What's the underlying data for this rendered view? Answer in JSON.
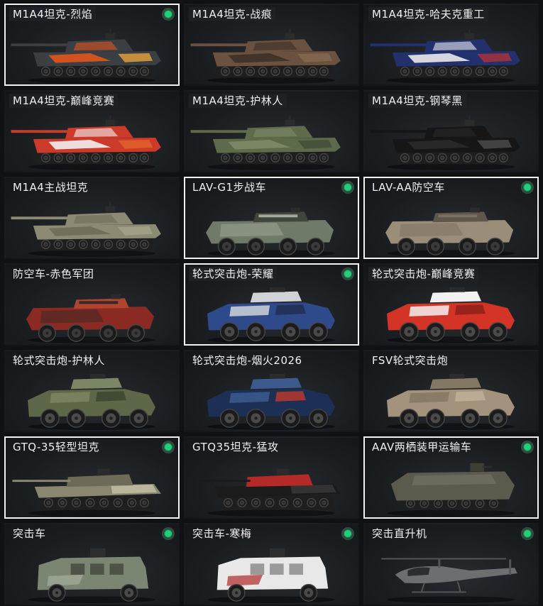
{
  "vehicles": [
    {
      "label": "M1A4坦克-烈焰",
      "type": "tank",
      "colors": [
        "#3a3f44",
        "#e0541c",
        "#ffb13b"
      ],
      "selected": true,
      "indicator": true,
      "label_bg": true
    },
    {
      "label": "M1A4坦克-战痕",
      "type": "tank",
      "colors": [
        "#6a5140",
        "#3f3128",
        "#8a6e52"
      ],
      "selected": false,
      "indicator": false,
      "label_bg": true
    },
    {
      "label": "M1A4坦克-哈夫克重工",
      "type": "tank",
      "colors": [
        "#22306e",
        "#eaeaea",
        "#c43030"
      ],
      "selected": false,
      "indicator": false,
      "label_bg": true
    },
    {
      "label": "M1A4坦克-巅峰竞赛",
      "type": "tank",
      "colors": [
        "#cc3a2a",
        "#f1f1f1",
        "#e56a2b"
      ],
      "selected": false,
      "indicator": false,
      "label_bg": true
    },
    {
      "label": "M1A4坦克-护林人",
      "type": "tank",
      "colors": [
        "#5e6b4a",
        "#7e8a68",
        "#3d4733"
      ],
      "selected": false,
      "indicator": false,
      "label_bg": true
    },
    {
      "label": "M1A4坦克-钢琴黑",
      "type": "tank",
      "colors": [
        "#161616",
        "#2a2a2a",
        "#555555"
      ],
      "selected": false,
      "indicator": false,
      "label_bg": true
    },
    {
      "label": "M1A4主战坦克",
      "type": "tank",
      "colors": [
        "#8c8a72",
        "#6e6c58",
        "#a8a68c"
      ],
      "selected": false,
      "indicator": false,
      "label_bg": false
    },
    {
      "label": "LAV-G1步战车",
      "type": "apc",
      "colors": [
        "#6f7a68",
        "#a3a99a",
        "#3f463c"
      ],
      "selected": true,
      "indicator": true,
      "label_bg": false
    },
    {
      "label": "LAV-AA防空车",
      "type": "apc",
      "colors": [
        "#9a8d7a",
        "#7b705f",
        "#5f574b"
      ],
      "selected": true,
      "indicator": true,
      "label_bg": false
    },
    {
      "label": "防空车-赤色军团",
      "type": "apc",
      "colors": [
        "#8a2a22",
        "#3a2624",
        "#b0442f"
      ],
      "selected": false,
      "indicator": false,
      "label_bg": false
    },
    {
      "label": "轮式突击炮-荣耀",
      "type": "armored_car",
      "colors": [
        "#2e4a8a",
        "#cfd3d8",
        "#1f2c4c"
      ],
      "selected": true,
      "indicator": true,
      "label_bg": true
    },
    {
      "label": "轮式突击炮-巅峰竞赛",
      "type": "armored_car",
      "colors": [
        "#d33426",
        "#f2f2f2",
        "#8a1f18"
      ],
      "selected": false,
      "indicator": false,
      "label_bg": true
    },
    {
      "label": "轮式突击炮-护林人",
      "type": "armored_car",
      "colors": [
        "#5c6848",
        "#7b8664",
        "#3a4330"
      ],
      "selected": false,
      "indicator": false,
      "label_bg": false
    },
    {
      "label": "轮式突击炮-烟火2026",
      "type": "armored_car",
      "colors": [
        "#1e2f55",
        "#3d5a8f",
        "#c03a2c"
      ],
      "selected": false,
      "indicator": false,
      "label_bg": false
    },
    {
      "label": "FSV轮式突击炮",
      "type": "armored_car",
      "colors": [
        "#a3937c",
        "#857863",
        "#c2b39a"
      ],
      "selected": false,
      "indicator": false,
      "label_bg": false
    },
    {
      "label": "GTQ-35轻型坦克",
      "type": "light_tank",
      "colors": [
        "#8a8770",
        "#6d6a57",
        "#c5c2aa"
      ],
      "selected": true,
      "indicator": true,
      "label_bg": false
    },
    {
      "label": "GTQ35坦克-猛攻",
      "type": "light_tank",
      "colors": [
        "#1b1b1b",
        "#b32a26",
        "#3a3a3a"
      ],
      "selected": false,
      "indicator": false,
      "label_bg": false
    },
    {
      "label": "AAV两栖装甲运输车",
      "type": "amphibious",
      "colors": [
        "#5b5a4d",
        "#77756a",
        "#3f3e35"
      ],
      "selected": true,
      "indicator": true,
      "label_bg": false
    },
    {
      "label": "突击车",
      "type": "mrap",
      "colors": [
        "#7b8672",
        "#a6ae9c",
        "#4d5447"
      ],
      "selected": false,
      "indicator": true,
      "label_bg": false
    },
    {
      "label": "突击车-寒梅",
      "type": "mrap",
      "colors": [
        "#e8e8e8",
        "#b02a2a",
        "#9a9a9a"
      ],
      "selected": false,
      "indicator": true,
      "label_bg": false
    },
    {
      "label": "突击直升机",
      "type": "helicopter",
      "colors": [
        "#6b6f70",
        "#8a8f90",
        "#454949"
      ],
      "selected": false,
      "indicator": true,
      "label_bg": false
    }
  ]
}
